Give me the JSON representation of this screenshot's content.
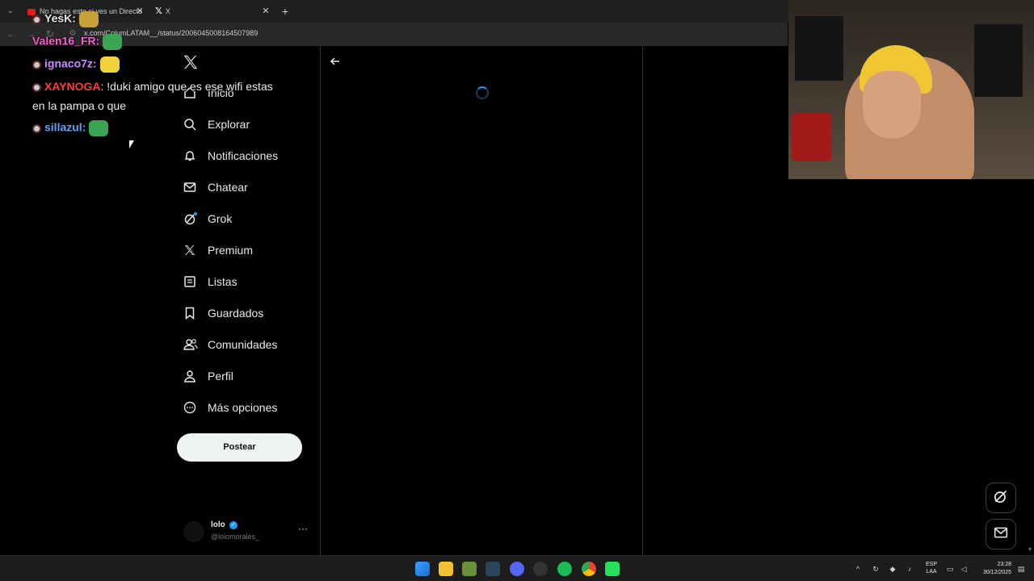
{
  "browser": {
    "tabs": [
      {
        "title": "No hagas esto si ves un Directo",
        "favicon": "youtube-icon"
      },
      {
        "title": "X",
        "favicon": "x-icon"
      }
    ],
    "tab_menu_icon": "chevron-down-icon",
    "new_tab_icon": "plus-icon",
    "url": "x.com/ColumLATAM__/status/2006045008164507989"
  },
  "sidebar": {
    "logo": "x-logo",
    "items": [
      {
        "label": "Inicio",
        "icon": "home-icon"
      },
      {
        "label": "Explorar",
        "icon": "search-icon"
      },
      {
        "label": "Notificaciones",
        "icon": "bell-icon"
      },
      {
        "label": "Chatear",
        "icon": "mail-icon"
      },
      {
        "label": "Grok",
        "icon": "grok-icon"
      },
      {
        "label": "Premium",
        "icon": "x-icon"
      },
      {
        "label": "Listas",
        "icon": "list-icon"
      },
      {
        "label": "Guardados",
        "icon": "bookmark-icon"
      },
      {
        "label": "Comunidades",
        "icon": "people-icon"
      },
      {
        "label": "Perfil",
        "icon": "person-icon"
      },
      {
        "label": "Más opciones",
        "icon": "more-circle-icon"
      }
    ],
    "post_button": "Postear",
    "account": {
      "name": "lolo",
      "handle": "@lolomorales_",
      "more": "···"
    }
  },
  "chat": {
    "messages": [
      {
        "user": "YesK",
        "color": "#e7e9ea",
        "text": ""
      },
      {
        "user": "Valen16_FR",
        "color": "#ff5bd6",
        "text": ""
      },
      {
        "user": "ignaco7z",
        "color": "#c98bff",
        "text": ""
      },
      {
        "user": "XAYNOGA",
        "color": "#ff3b3b",
        "text": "!duki amigo que es ese wifi estas"
      },
      {
        "user": "",
        "color": "#e7e9ea",
        "text": "en la pampa o que"
      },
      {
        "user": "sillazul",
        "color": "#5ba4ff",
        "text": ""
      }
    ]
  },
  "fabs": {
    "grok": "grok-icon",
    "messages": "mail-icon"
  },
  "taskbar": {
    "lang_top": "ESP",
    "lang_bottom": "LAA",
    "time": "23:28",
    "date": "30/12/2025"
  },
  "colors": {
    "accent": "#1d9bf0",
    "post_bg": "#eff3f4"
  }
}
